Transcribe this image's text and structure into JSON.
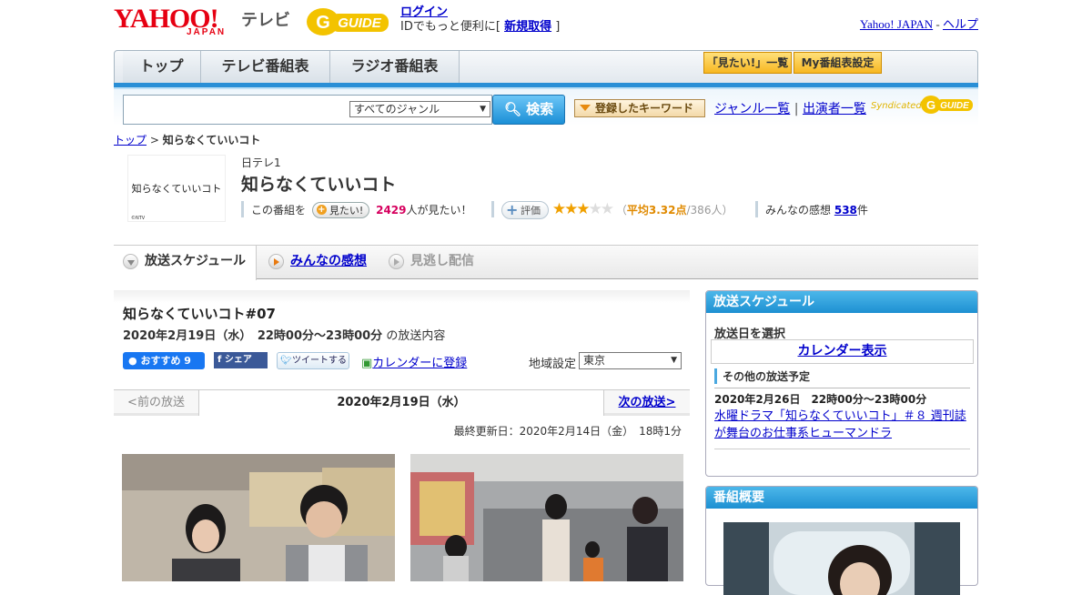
{
  "header": {
    "yahoo_logo": "YAHOO!",
    "yahoo_logo_sub": "JAPAN",
    "tv_label": "テレビ",
    "gguide_logo": "GUIDE",
    "login_label": "ログイン",
    "id_text_prefix": "IDでもっと便利に[",
    "register_label": "新規取得",
    "id_text_suffix": "]",
    "yahoo_japan_link": "Yahoo! JAPAN",
    "separator": "-",
    "help_link": "ヘルプ"
  },
  "nav": {
    "tabs": [
      {
        "label": "トップ"
      },
      {
        "label": "テレビ番組表"
      },
      {
        "label": "ラジオ番組表"
      }
    ],
    "mitai_list_label": "「見たい!」一覧",
    "my_bangumi_label": "My番組表設定"
  },
  "search": {
    "input_value": "",
    "genre_selected": "すべてのジャンル",
    "search_label": "検索",
    "keyword_label": "登録したキーワード",
    "genre_list_link": "ジャンル一覧",
    "link_sep": "|",
    "performer_link": "出演者一覧",
    "syndicated": "Syndicated",
    "syndicated_logo": "GUIDE"
  },
  "breadcrumb": {
    "top": "トップ",
    "sep": ">",
    "current": "知らなくていいコト"
  },
  "program": {
    "thumb_title": "知らなくていいコト",
    "thumb_credit": "©NTV",
    "station": "日テレ1",
    "title": "知らなくていいコト",
    "mitai_prefix": "この番組を",
    "mitai_btn": "見たい!",
    "mitai_count": "2429",
    "mitai_suffix": "人が見たい！",
    "eval_btn": "評価",
    "rating": 3.32,
    "stars_on": "★★★",
    "stars_off": "★★",
    "avg_open": "（",
    "avg_label": "平均3.32点",
    "avg_people": "/386人）",
    "kansou_prefix": "みんなの感想",
    "kansou_count": "538",
    "kansou_suffix": "件"
  },
  "tabs": {
    "schedule": "放送スケジュール",
    "minna": "みんなの感想",
    "minogashi": "見逃し配信"
  },
  "episode": {
    "title": "知らなくていいコト#07",
    "date_bold": "2020年2月19日（水）　22時00分～23時00分",
    "date_suffix": "の放送内容",
    "fb_label": "おすすめ 9",
    "fb_share": "シェア",
    "tweet_label": "ツイートする",
    "calendar_link": "カレンダーに登録",
    "region_label": "地域設定",
    "region_value": "東京",
    "prev_label": "<前の放送",
    "current_date": "2020年2月19日（水）",
    "next_label": "次の放送>",
    "updated": "最終更新日：2020年2月14日（金）　18時1分"
  },
  "sidebar": {
    "schedule_title": "放送スケジュール",
    "select_date": "放送日を選択",
    "calendar_btn": "カレンダー表示",
    "other_head": "その他の放送予定",
    "other_date": "2020年2月26日　22時00分～23時00分",
    "other_link": "水曜ドラマ「知らなくていいコト」＃８ 週刊誌が舞台のお仕事系ヒューマンドラ",
    "overview_title": "番組概要"
  },
  "colors": {
    "accent_blue": "#1e90d2",
    "link": "#0000cc",
    "brand_red": "#e60012",
    "gguide_yellow": "#f3c300",
    "mitai_pink": "#d6005e",
    "star_gold": "#f0a000"
  }
}
